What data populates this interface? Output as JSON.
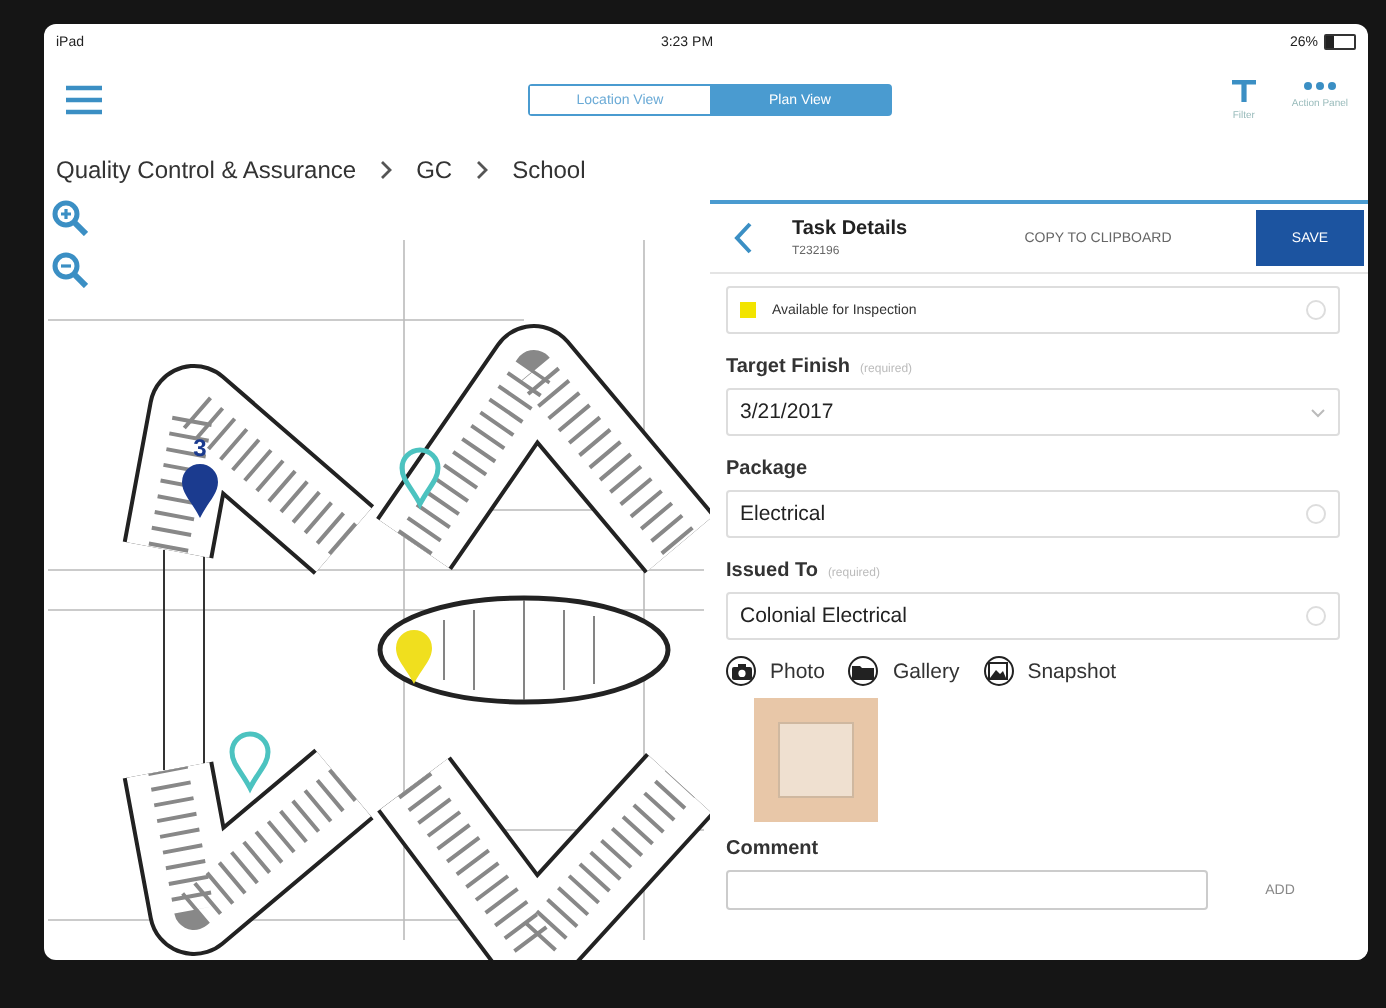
{
  "status_bar": {
    "carrier": "iPad",
    "time": "3:23 PM",
    "battery": "26%"
  },
  "nav": {
    "segments": [
      {
        "label": "Location View",
        "selected": false
      },
      {
        "label": "Plan View",
        "selected": true
      }
    ],
    "actions": [
      {
        "label": "Filter",
        "kind": "filter"
      },
      {
        "label": "Action Panel",
        "kind": "more"
      }
    ]
  },
  "breadcrumb": [
    "Quality Control & Assurance",
    "GC",
    "School"
  ],
  "plan": {
    "pins": [
      {
        "label": "3",
        "color": "#1b3b8f",
        "kind": "solid"
      },
      {
        "color": "#4cc3c0",
        "kind": "outline"
      },
      {
        "color": "#f0df1e",
        "kind": "solid"
      },
      {
        "color": "#4cc3c0",
        "kind": "outline"
      }
    ]
  },
  "task": {
    "title": "Task Details",
    "id": "T232196",
    "copy_button": "COPY TO CLIPBOARD",
    "save_button": "SAVE",
    "status": {
      "label": "Available for Inspection",
      "color": "#f2e400"
    },
    "fields": [
      {
        "kind": "date",
        "label": "Target Finish",
        "note": "(required)",
        "value": "3/21/2017"
      },
      {
        "kind": "text",
        "label": "Package",
        "value": "Electrical"
      },
      {
        "kind": "text",
        "label": "Issued To",
        "note": "(required)",
        "value": "Colonial Electrical"
      }
    ],
    "attachments": [
      {
        "kind": "camera",
        "label": "Photo"
      },
      {
        "kind": "folder",
        "label": "Gallery"
      },
      {
        "kind": "image",
        "label": "Snapshot"
      }
    ],
    "comment": {
      "label": "Comment",
      "button": "ADD"
    }
  }
}
